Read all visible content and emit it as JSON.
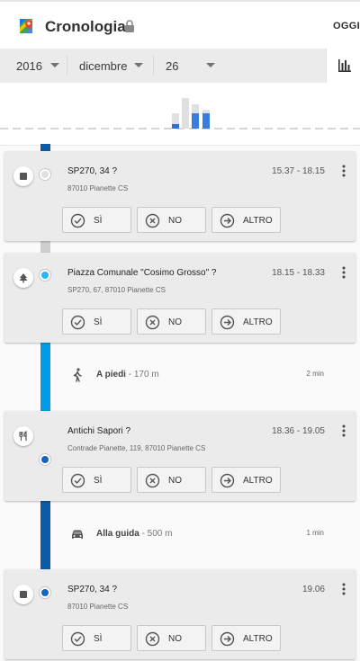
{
  "app": {
    "title": "Cronologia",
    "today_label": "OGGI"
  },
  "date": {
    "year": "2016",
    "month": "dicembre",
    "day": "26"
  },
  "places": [
    {
      "title": "SP270, 34 ?",
      "time": "15.37 - 18.15",
      "address": "87010 Pianette CS",
      "category_icon": "place-icon"
    },
    {
      "title": "Piazza Comunale \"Cosimo Grosso\" ?",
      "time": "18.15 - 18.33",
      "address": "SP270, 67, 87010 Pianette CS",
      "category_icon": "tree-icon"
    },
    {
      "title": "Antichi Sapori ?",
      "time": "18.36 - 19.05",
      "address": "Contrade Pianette, 119, 87010 Pianette CS",
      "category_icon": "restaurant-icon"
    },
    {
      "title": "SP270, 34 ?",
      "time": "19.06",
      "address": "87010 Pianette CS",
      "category_icon": "place-icon"
    }
  ],
  "actions": {
    "yes": "SÌ",
    "no": "NO",
    "other": "ALTRO"
  },
  "moves": [
    {
      "mode": "A piedi",
      "distance": "- 170 m",
      "duration": "2 min",
      "icon": "walking-icon"
    },
    {
      "mode": "Alla guida",
      "distance": "- 500 m",
      "duration": "1 min",
      "icon": "car-icon"
    }
  ],
  "colors": {
    "accent": "#4285f4",
    "walk": "#03a9f4",
    "drive": "#0d5aa7",
    "still": "#bdbdbd"
  }
}
